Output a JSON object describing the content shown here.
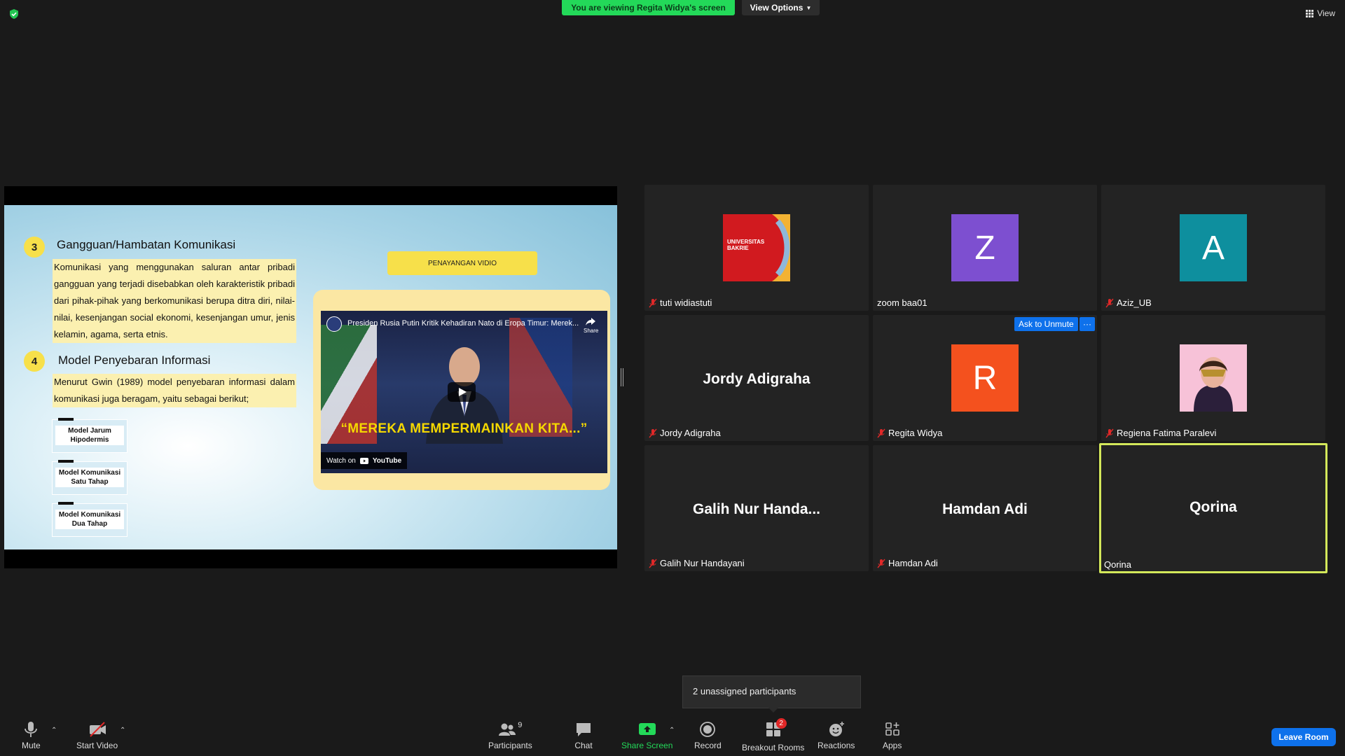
{
  "top": {
    "viewing_banner": "You are viewing Regita Widya's screen",
    "view_options": "View Options",
    "view": "View"
  },
  "slide": {
    "item3_num": "3",
    "item3_title": "Gangguan/Hambatan Komunikasi",
    "item3_text": "Komunikasi yang menggunakan saluran antar pribadi gangguan yang terjadi disebabkan oleh karakteristik pribadi dari pihak-pihak yang berkomunikasi berupa ditra diri, nilai-nilai, kesenjangan social ekonomi, kesenjangan umur, jenis kelamin, agama, serta etnis.",
    "item4_num": "4",
    "item4_title": "Model Penyebaran Informasi",
    "item4_text": "Menurut Gwin (1989) model penyebaran informasi dalam komunikasi juga beragam, yaitu sebagai berikut;",
    "models": [
      {
        "line1": "Model Jarum",
        "line2": "Hipodermis"
      },
      {
        "line1": "Model Komunikasi",
        "line2": "Satu Tahap"
      },
      {
        "line1": "Model Komunikasi",
        "line2": "Dua Tahap"
      }
    ],
    "video_button": "PENAYANGAN VIDIO",
    "video_title": "Presiden Rusia Putin Kritik Kehadiran Nato di Eropa Timur: Merek...",
    "video_caption": "“MEREKA MEMPERMAINKAN KITA...”",
    "watch_on": "Watch on",
    "youtube": "YouTube",
    "share": "Share"
  },
  "tiles": [
    {
      "name": "tuti widiastuti",
      "muted": true
    },
    {
      "name": "zoom baa01",
      "muted": false,
      "avatar_letter": "Z",
      "avatar_color": "#7d4fd0"
    },
    {
      "name": "Aziz_UB",
      "muted": true,
      "avatar_letter": "A",
      "avatar_color": "#0e8f9e"
    },
    {
      "name": "Jordy Adigraha",
      "muted": true,
      "display": "Jordy Adigraha"
    },
    {
      "name": "Regita Widya",
      "muted": true,
      "avatar_letter": "R",
      "avatar_color": "#f4511e"
    },
    {
      "name": "Regiena Fatima Paralevi",
      "muted": true
    },
    {
      "name": "Galih Nur Handayani",
      "muted": true,
      "display": "Galih Nur Handa..."
    },
    {
      "name": "Hamdan Adi",
      "muted": true,
      "display": "Hamdan Adi"
    },
    {
      "name": "Qorina",
      "muted": false,
      "display": "Qorina"
    }
  ],
  "university_logo": {
    "line1": "UNIVERSITAS",
    "line2": "BAKRIE"
  },
  "ask_unmute": "Ask to Unmute",
  "more": "···",
  "unassigned_tooltip": "2 unassigned participants",
  "toolbar": {
    "mute": "Mute",
    "start_video": "Start Video",
    "participants": "Participants",
    "participants_count": "9",
    "chat": "Chat",
    "share_screen": "Share Screen",
    "record": "Record",
    "breakout_rooms": "Breakout Rooms",
    "breakout_badge": "2",
    "reactions": "Reactions",
    "apps": "Apps",
    "leave_room": "Leave Room"
  },
  "colors": {
    "accent_blue": "#0e71eb",
    "banner_green": "#23d959",
    "active_border": "#d3e85a",
    "share_green": "#23d959"
  }
}
